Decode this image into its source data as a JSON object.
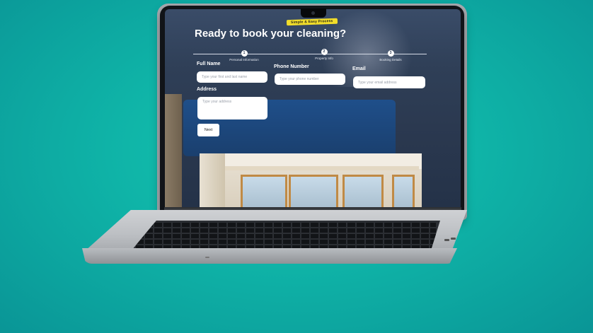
{
  "badge": "Simple & Easy Process",
  "title": "Ready to book your cleaning?",
  "steps": [
    {
      "number": "1",
      "label": "Personal Information"
    },
    {
      "number": "2",
      "label": "Property Info"
    },
    {
      "number": "3",
      "label": "Booking Details"
    }
  ],
  "form": {
    "full_name": {
      "label": "Full Name",
      "placeholder": "Type your first and last name"
    },
    "phone": {
      "label": "Phone Number",
      "placeholder": "Type your phone number"
    },
    "email": {
      "label": "Email",
      "placeholder": "Type your email address"
    },
    "address": {
      "label": "Address",
      "placeholder": "Type your address"
    },
    "next_label": "Next"
  },
  "colors": {
    "background": "#0fb3a7",
    "screen": "#2f3f57",
    "badge": "#f1dd2a"
  }
}
